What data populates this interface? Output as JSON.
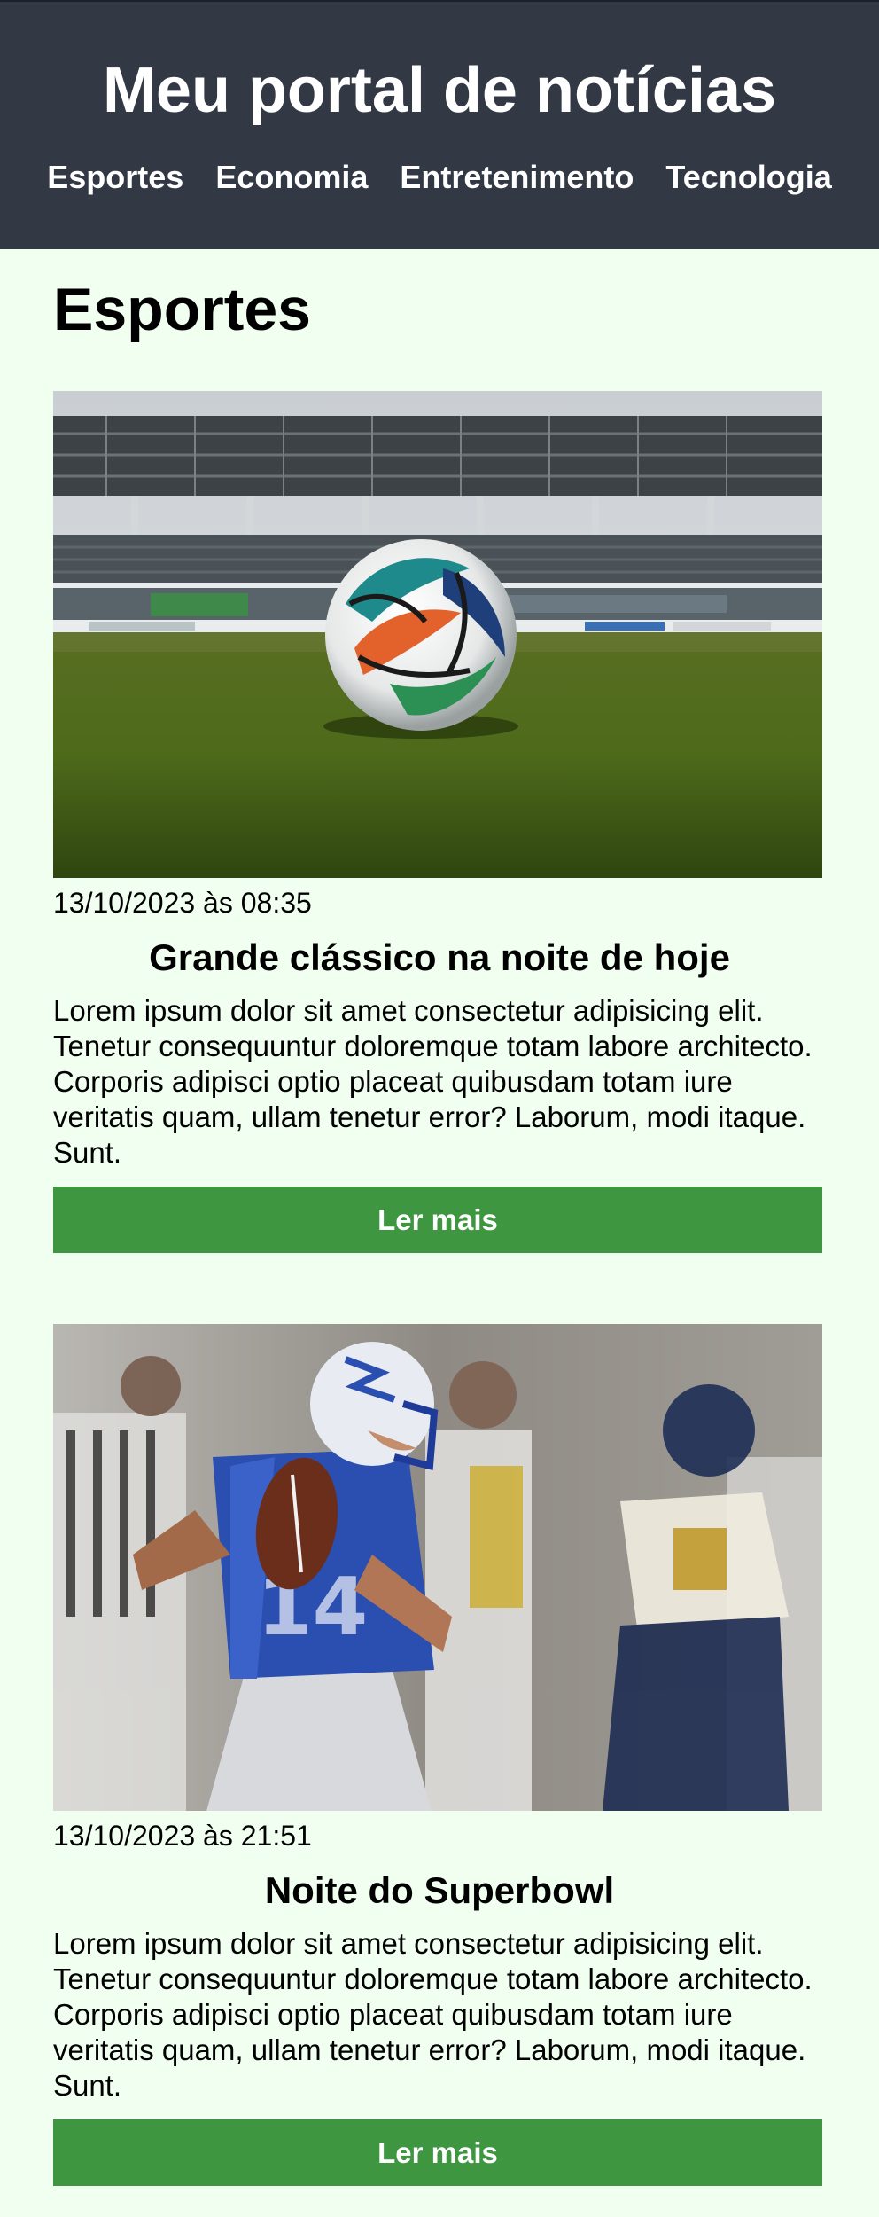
{
  "header": {
    "title": "Meu portal de notícias",
    "nav": [
      "Esportes",
      "Economia",
      "Entretenimento",
      "Tecnologia"
    ]
  },
  "section": {
    "title": "Esportes"
  },
  "articles": [
    {
      "image": "soccer-ball-stadium-photo",
      "date": "13/10/2023 às 08:35",
      "title": "Grande clássico na noite de hoje",
      "text": "Lorem ipsum dolor sit amet consectetur adipisicing elit. Tenetur consequuntur doloremque totam labore architecto. Corporis adipisci optio placeat quibusdam totam iure veritatis quam, ullam tenetur error? Laborum, modi itaque. Sunt.",
      "button": "Ler mais"
    },
    {
      "image": "american-football-quarterback-photo",
      "date": "13/10/2023 às 21:51",
      "title": "Noite do Superbowl",
      "text": "Lorem ipsum dolor sit amet consectetur adipisicing elit. Tenetur consequuntur doloremque totam labore architecto. Corporis adipisci optio placeat quibusdam totam iure veritatis quam, ullam tenetur error? Laborum, modi itaque. Sunt.",
      "button": "Ler mais"
    }
  ],
  "colors": {
    "header_bg": "#323844",
    "page_bg": "#f0fff0",
    "button_bg": "#3f9641"
  }
}
